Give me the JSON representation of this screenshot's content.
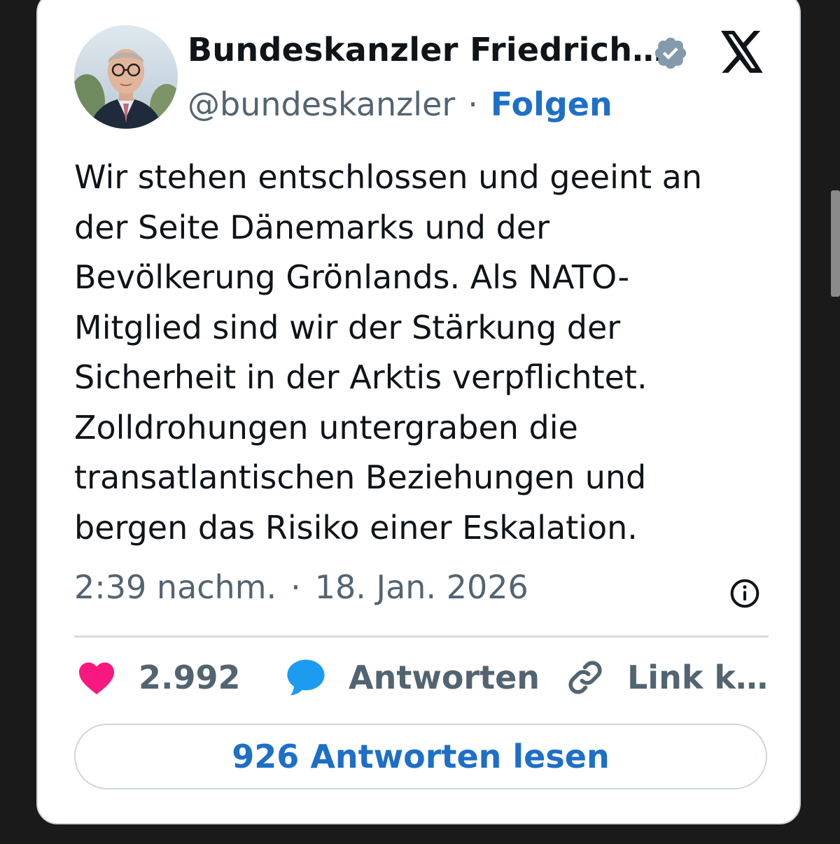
{
  "author": {
    "display_name": "Bundeskanzler Friedrich…",
    "handle": "@bundeskanzler",
    "separator": "·",
    "follow_label": "Folgen",
    "verified_icon": "verified-badge-icon",
    "verified_color": "#829aab"
  },
  "platform": {
    "logo_icon": "x-logo-icon"
  },
  "tweet": {
    "text": "Wir stehen entschlossen und geeint an\nder Seite Dänemarks und der\nBevölkerung Grönlands. Als NATO-\nMitglied sind wir der Stärkung der\nSicherheit in der Arktis verpflichtet.\nZolldrohungen untergraben die\ntransatlantischen Beziehungen und\nbergen das Risiko einer Eskalation.",
    "time": "2:39 nachm.",
    "separator": "·",
    "date": "18. Jan. 2026",
    "info_icon": "info-icon"
  },
  "actions": {
    "like": {
      "icon": "heart-icon",
      "count": "2.992",
      "color": "#f91880"
    },
    "reply": {
      "icon": "speech-bubble-icon",
      "label": "Antworten",
      "color": "#1d9bf0"
    },
    "link": {
      "icon": "link-icon",
      "label": "Link k…"
    }
  },
  "read_replies_button": "926 Antworten lesen",
  "colors": {
    "accent": "#1d6fc7",
    "text_primary": "#0f1419",
    "text_secondary": "#536471",
    "background": "#1a1a1a"
  }
}
